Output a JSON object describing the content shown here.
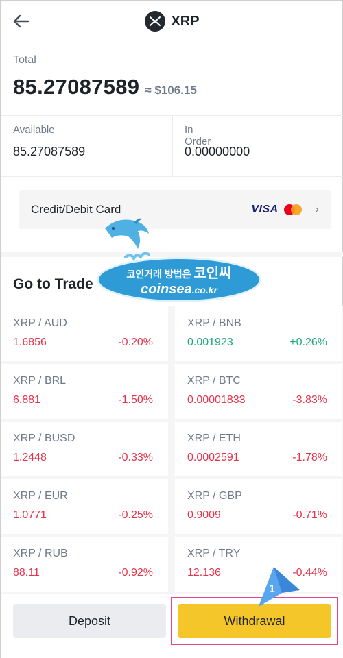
{
  "header": {
    "title": "XRP",
    "back_icon": "arrow-left-icon",
    "coin_icon": "xrp-logo-icon"
  },
  "total": {
    "label": "Total",
    "value": "85.27087589",
    "fiat": "≈ $106.15"
  },
  "balances": {
    "available_label": "Available",
    "available_value": "85.27087589",
    "in_order_label": "In Order",
    "in_order_value": "0.00000000"
  },
  "card": {
    "label": "Credit/Debit Card",
    "visa": "VISA",
    "chevron_icon": "chevron-right-icon"
  },
  "trade": {
    "title": "Go to Trade",
    "pairs": [
      {
        "pair": "XRP / AUD",
        "price": "1.6856",
        "change": "-0.20%",
        "dir": "down"
      },
      {
        "pair": "XRP / BNB",
        "price": "0.001923",
        "change": "+0.26%",
        "dir": "up"
      },
      {
        "pair": "XRP / BRL",
        "price": "6.881",
        "change": "-1.50%",
        "dir": "down"
      },
      {
        "pair": "XRP / BTC",
        "price": "0.00001833",
        "change": "-3.83%",
        "dir": "down"
      },
      {
        "pair": "XRP / BUSD",
        "price": "1.2448",
        "change": "-0.33%",
        "dir": "down"
      },
      {
        "pair": "XRP / ETH",
        "price": "0.0002591",
        "change": "-1.78%",
        "dir": "down"
      },
      {
        "pair": "XRP / EUR",
        "price": "1.0771",
        "change": "-0.25%",
        "dir": "down"
      },
      {
        "pair": "XRP / GBP",
        "price": "0.9009",
        "change": "-0.71%",
        "dir": "down"
      },
      {
        "pair": "XRP / RUB",
        "price": "88.11",
        "change": "-0.92%",
        "dir": "down"
      },
      {
        "pair": "XRP / TRY",
        "price": "12.136",
        "change": "-0.44%",
        "dir": "down"
      }
    ]
  },
  "actions": {
    "deposit": "Deposit",
    "withdrawal": "Withdrawal"
  },
  "watermark": {
    "korean_small": "코인거래 방법은",
    "korean_big": "코인씨",
    "domain_main": "coinsea",
    "domain_suffix": ".co.kr"
  },
  "annotation": {
    "step": "1"
  },
  "colors": {
    "up": "#1aa97a",
    "down": "#e5334b",
    "accent": "#f5c62a",
    "highlight": "#e5458c"
  }
}
